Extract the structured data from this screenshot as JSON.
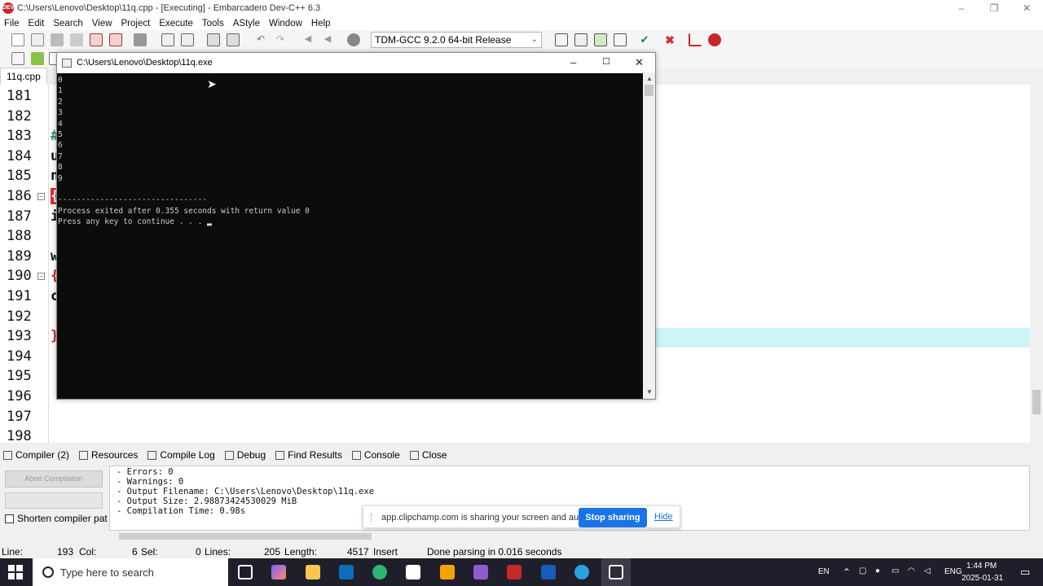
{
  "window": {
    "title": "C:\\Users\\Lenovo\\Desktop\\11q.cpp - [Executing] - Embarcadero Dev-C++ 6.3",
    "app_icon": "DEV",
    "controls": [
      "–",
      "❐",
      "✕"
    ]
  },
  "menu": [
    "File",
    "Edit",
    "Search",
    "View",
    "Project",
    "Execute",
    "Tools",
    "AStyle",
    "Window",
    "Help"
  ],
  "toolbar": {
    "compiler": "TDM-GCC 9.2.0 64-bit Release",
    "icons": [
      "new-file-icon",
      "open-icon",
      "save-icon",
      "save-all-icon",
      "close-icon",
      "close-all-icon",
      "print-icon",
      "find-icon",
      "replace-icon",
      "goto-icon",
      "indent-icon",
      "undo-icon",
      "redo-icon",
      "back-icon",
      "forward-icon",
      "bookmark-icon",
      "grid-icon",
      "layout-icon",
      "window-icon",
      "tiles-icon",
      "check-icon",
      "stop-icon",
      "chart-icon",
      "debug-icon"
    ]
  },
  "editor": {
    "tab": "11q.cpp",
    "lines": [
      {
        "num": "181",
        "code": ""
      },
      {
        "num": "182",
        "code": ""
      },
      {
        "num": "183",
        "code": "#",
        "color": "#2e8b57"
      },
      {
        "num": "184",
        "code": "u",
        "color": "#111111"
      },
      {
        "num": "185",
        "code": "n",
        "color": "#111111"
      },
      {
        "num": "186",
        "code": "{",
        "color": "#ffffff",
        "bg": "#d32f2f"
      },
      {
        "num": "187",
        "code": "i",
        "color": "#111111"
      },
      {
        "num": "188",
        "code": ""
      },
      {
        "num": "189",
        "code": "w",
        "color": "#111111"
      },
      {
        "num": "190",
        "code": "{",
        "color": "#c62828"
      },
      {
        "num": "191",
        "code": "c",
        "color": "#111111"
      },
      {
        "num": "192",
        "code": ""
      },
      {
        "num": "193",
        "code": "}",
        "color": "#c62828"
      },
      {
        "num": "194",
        "code": ""
      },
      {
        "num": "195",
        "code": ""
      },
      {
        "num": "196",
        "code": ""
      },
      {
        "num": "197",
        "code": ""
      },
      {
        "num": "198",
        "code": ""
      }
    ]
  },
  "console": {
    "title": "C:\\Users\\Lenovo\\Desktop\\11q.exe",
    "output": "0\n1\n2\n3\n4\n5\n6\n7\n8\n9\n\n--------------------------------\nProcess exited after 0.355 seconds with return value 0\nPress any key to continue . . . ",
    "cursor": "▂"
  },
  "bottom_panel": {
    "tabs": [
      "Compiler (2)",
      "Resources",
      "Compile Log",
      "Debug",
      "Find Results",
      "Console",
      "Close"
    ],
    "abort_button": "Abort Compilation",
    "shorten_label": "Shorten compiler pat",
    "log": "- Errors: 0\n- Warnings: 0\n- Output Filename: C:\\Users\\Lenovo\\Desktop\\11q.exe\n- Output Size: 2.98873424530029 MiB\n- Compilation Time: 0.98s"
  },
  "sharebar": {
    "message": "app.clipchamp.com is sharing your screen and audio.",
    "stop": "Stop sharing",
    "hide": "Hide"
  },
  "status": {
    "line_label": "Line:",
    "line": "193",
    "col_label": "Col:",
    "col": "6",
    "sel_label": "Sel:",
    "sel": "0",
    "lines_label": "Lines:",
    "lines": "205",
    "length_label": "Length:",
    "length": "4517",
    "mode": "Insert",
    "parse": "Done parsing in 0.016 seconds"
  },
  "taskbar": {
    "search_placeholder": "Type here to search",
    "lang": "EN",
    "input": "ENG",
    "time": "1:44 PM",
    "date": "2025-01-31"
  }
}
